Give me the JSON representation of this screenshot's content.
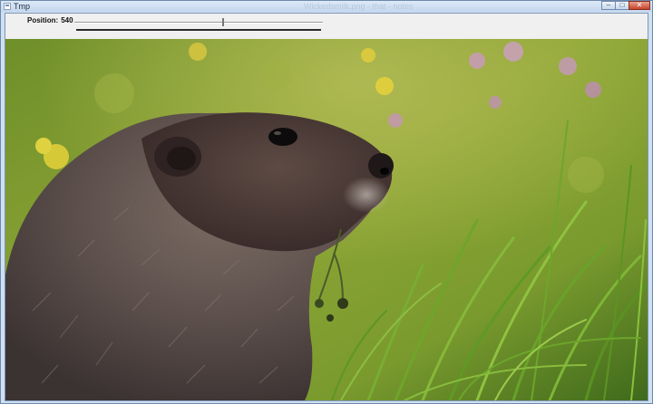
{
  "window": {
    "title": "Tmp",
    "ghost_title": "Wickedsmilk.png - that - notes",
    "minimize_symbol": "‒",
    "maximize_symbol": "□",
    "close_symbol": "✕"
  },
  "toolbar": {
    "position_label": "Position:",
    "position_value": "540",
    "slider_fraction": 0.6
  },
  "icons": {
    "app": "window-icon",
    "minimize": "minimize-icon",
    "maximize": "maximize-icon",
    "close": "close-icon"
  },
  "colors": {
    "title_bar": "#c4d7ee",
    "close_button": "#c7442c",
    "toolbar_bg": "#f0f0f0"
  }
}
